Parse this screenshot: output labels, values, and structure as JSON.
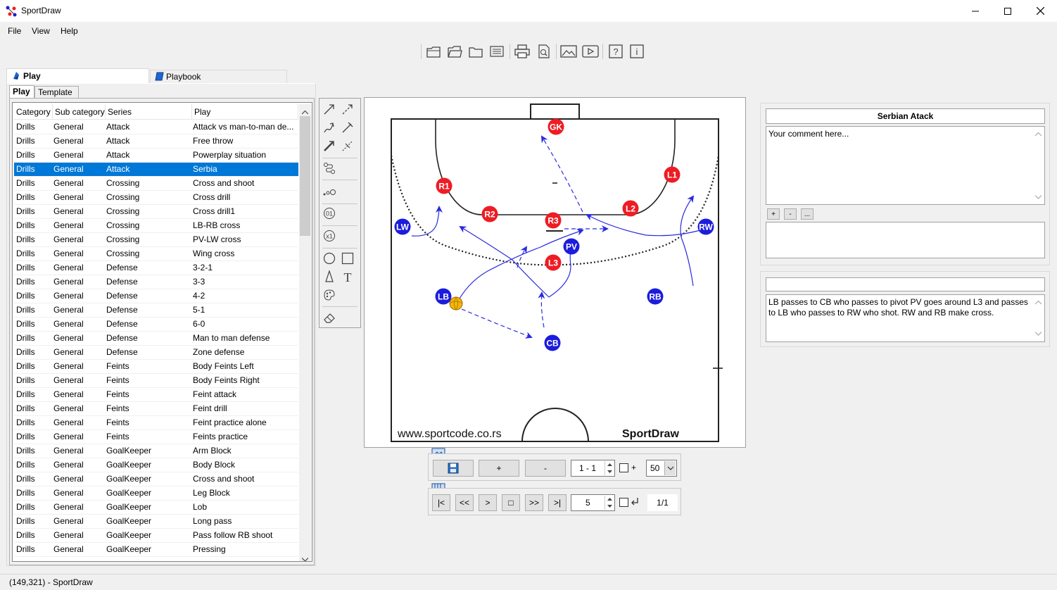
{
  "window": {
    "title": "SportDraw"
  },
  "menu": [
    "File",
    "View",
    "Help"
  ],
  "toolbar_icons": [
    "new-icon",
    "open-icon",
    "folder-icon",
    "list-icon",
    "print-icon",
    "print-preview-icon",
    "image-icon",
    "video-icon",
    "help-icon",
    "info-icon"
  ],
  "tabs": {
    "main": [
      "Play",
      "Playbook"
    ],
    "sub": [
      "Play",
      "Template"
    ]
  },
  "table": {
    "columns": [
      "Category",
      "Sub category",
      "Series",
      "Play"
    ],
    "selected_index": 3,
    "rows": [
      [
        "Drills",
        "General",
        "Attack",
        "Attack vs man-to-man de..."
      ],
      [
        "Drills",
        "General",
        "Attack",
        "Free throw"
      ],
      [
        "Drills",
        "General",
        "Attack",
        "Powerplay situation"
      ],
      [
        "Drills",
        "General",
        "Attack",
        "Serbia"
      ],
      [
        "Drills",
        "General",
        "Crossing",
        "Cross and shoot"
      ],
      [
        "Drills",
        "General",
        "Crossing",
        "Cross drill"
      ],
      [
        "Drills",
        "General",
        "Crossing",
        "Cross drill1"
      ],
      [
        "Drills",
        "General",
        "Crossing",
        "LB-RB cross"
      ],
      [
        "Drills",
        "General",
        "Crossing",
        "PV-LW cross"
      ],
      [
        "Drills",
        "General",
        "Crossing",
        "Wing cross"
      ],
      [
        "Drills",
        "General",
        "Defense",
        "3-2-1"
      ],
      [
        "Drills",
        "General",
        "Defense",
        "3-3"
      ],
      [
        "Drills",
        "General",
        "Defense",
        "4-2"
      ],
      [
        "Drills",
        "General",
        "Defense",
        "5-1"
      ],
      [
        "Drills",
        "General",
        "Defense",
        "6-0"
      ],
      [
        "Drills",
        "General",
        "Defense",
        "Man to man defense"
      ],
      [
        "Drills",
        "General",
        "Defense",
        "Zone defense"
      ],
      [
        "Drills",
        "General",
        "Feints",
        "Body Feints Left"
      ],
      [
        "Drills",
        "General",
        "Feints",
        "Body Feints Right"
      ],
      [
        "Drills",
        "General",
        "Feints",
        "Feint attack"
      ],
      [
        "Drills",
        "General",
        "Feints",
        "Feint drill"
      ],
      [
        "Drills",
        "General",
        "Feints",
        "Feint practice alone"
      ],
      [
        "Drills",
        "General",
        "Feints",
        "Feints practice"
      ],
      [
        "Drills",
        "General",
        "GoalKeeper",
        "Arm Block"
      ],
      [
        "Drills",
        "General",
        "GoalKeeper",
        "Body Block"
      ],
      [
        "Drills",
        "General",
        "GoalKeeper",
        "Cross and shoot"
      ],
      [
        "Drills",
        "General",
        "GoalKeeper",
        "Leg Block"
      ],
      [
        "Drills",
        "General",
        "GoalKeeper",
        "Lob"
      ],
      [
        "Drills",
        "General",
        "GoalKeeper",
        "Long pass"
      ],
      [
        "Drills",
        "General",
        "GoalKeeper",
        "Pass follow RB shoot"
      ],
      [
        "Drills",
        "General",
        "GoalKeeper",
        "Pressing"
      ]
    ]
  },
  "court": {
    "website": "www.sportcode.co.rs",
    "brand": "SportDraw",
    "defense_color": "#ee1c24",
    "attack_color": "#1c1cdd",
    "defense_players": [
      "GK",
      "R1",
      "R2",
      "R3",
      "L2",
      "L1",
      "L3"
    ],
    "attack_players": [
      "LW",
      "PV",
      "RW",
      "LB",
      "RB",
      "CB"
    ]
  },
  "frame_controls": {
    "add": "+",
    "remove": "-",
    "frame_range": "1 - 1",
    "plus_check": "+",
    "zoom": "50"
  },
  "playback": {
    "first": "|<",
    "prev": "<<",
    "play": ">",
    "stop": "□",
    "next": ">>",
    "last": ">|",
    "speed": "5",
    "counter": "1/1"
  },
  "info": {
    "play_title": "Serbian Atack",
    "comment_placeholder": "Your comment here...",
    "btn_add": "+",
    "btn_remove": "-",
    "btn_more": "...",
    "description": "LB passes to CB who passes to pivot PV goes around L3 and passes to LB who passes to RW who shot. RW and RB make cross."
  },
  "status": {
    "text": "(149,321) - SportDraw"
  }
}
